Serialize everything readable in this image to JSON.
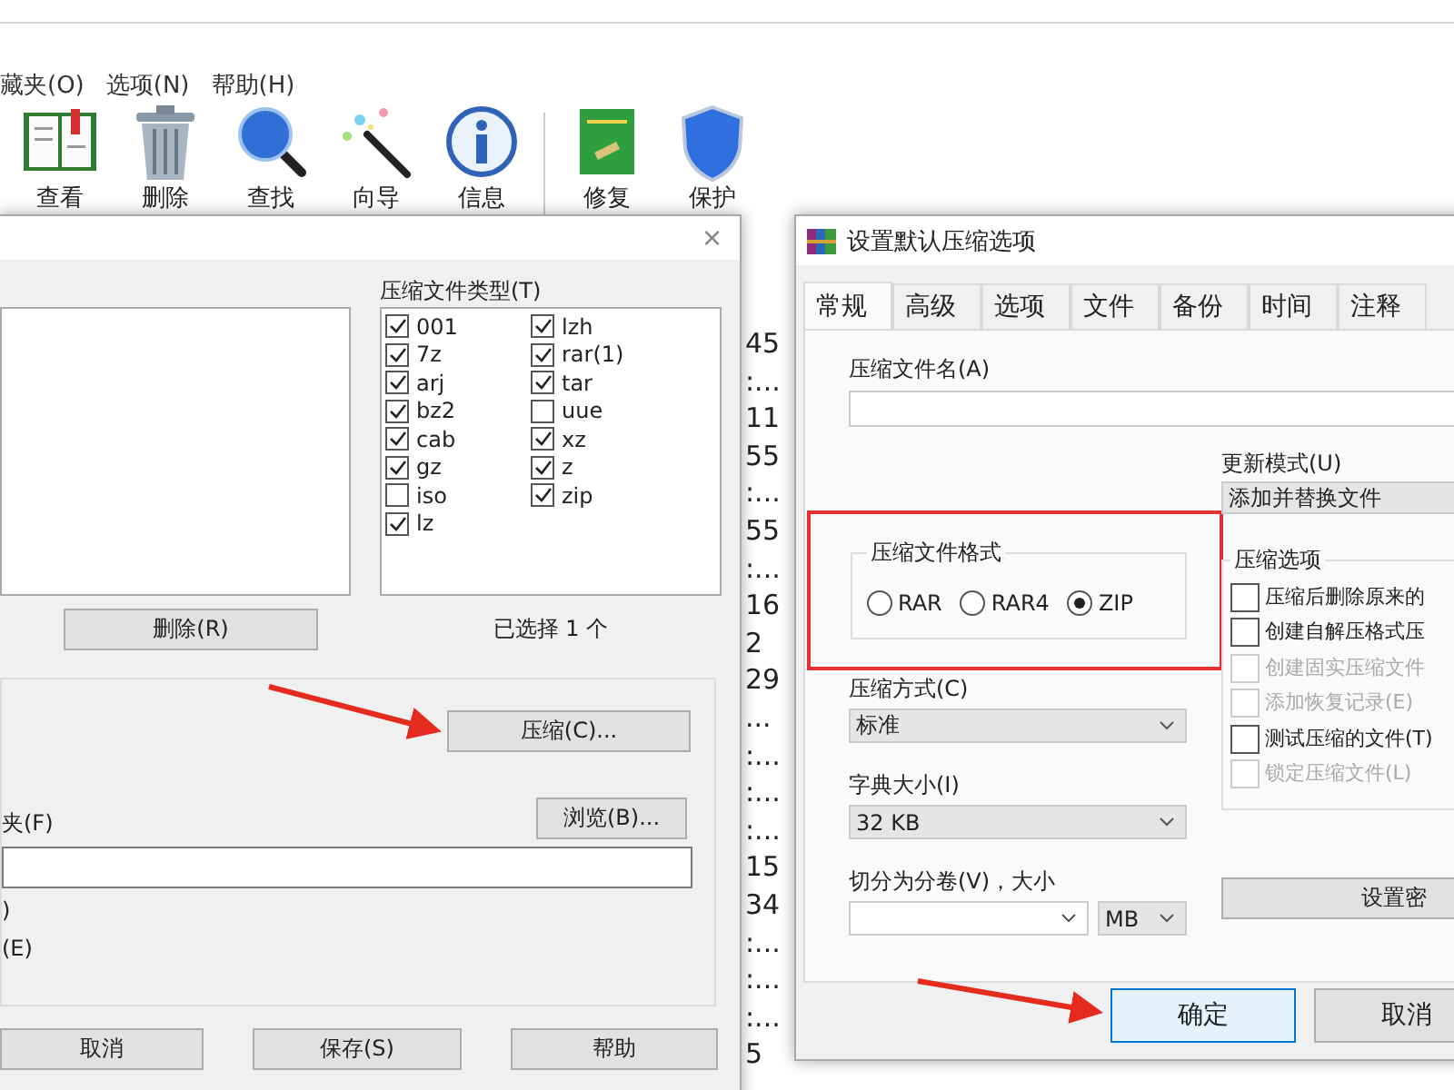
{
  "main_window": {
    "menu": [
      "藏夹(O)",
      "选项(N)",
      "帮助(H)"
    ],
    "toolbar_groups": [
      {
        "buttons": [
          {
            "label": "查看",
            "kind": "book"
          },
          {
            "label": "删除",
            "kind": "trash"
          },
          {
            "label": "查找",
            "kind": "magnifier"
          },
          {
            "label": "向导",
            "kind": "wand"
          },
          {
            "label": "信息",
            "kind": "info"
          }
        ]
      },
      {
        "buttons": [
          {
            "label": "修复",
            "kind": "repair"
          },
          {
            "label": "保护",
            "kind": "shield"
          }
        ]
      }
    ],
    "list_column": [
      "45",
      ":...",
      "11",
      "55",
      ":...",
      "55",
      ":...",
      "16",
      "2",
      "29",
      "...",
      ":...",
      ":...",
      ":...",
      "15",
      "34",
      ":...",
      ":...",
      ":...",
      "5"
    ]
  },
  "archive_types_dialog": {
    "close": "×",
    "types_label": "压缩文件类型(T)",
    "types": [
      {
        "label": "001",
        "checked": true
      },
      {
        "label": "7z",
        "checked": true
      },
      {
        "label": "arj",
        "checked": true
      },
      {
        "label": "bz2",
        "checked": true
      },
      {
        "label": "cab",
        "checked": true
      },
      {
        "label": "gz",
        "checked": true
      },
      {
        "label": "iso",
        "checked": false
      },
      {
        "label": "lz",
        "checked": true
      },
      {
        "label": "lzh",
        "checked": true
      },
      {
        "label": "rar(1)",
        "checked": true
      },
      {
        "label": "tar",
        "checked": true
      },
      {
        "label": "uue",
        "checked": false
      },
      {
        "label": "xz",
        "checked": true
      },
      {
        "label": "z",
        "checked": true
      },
      {
        "label": "zip",
        "checked": true
      }
    ],
    "delete_button": "删除(R)",
    "selection_count": "已选择 1 个",
    "compress_button": "压缩(C)...",
    "folder_label": "夹(F)",
    "browse_button": "浏览(B)...",
    "option_lines": [
      ")",
      "(E)"
    ],
    "buttons": [
      "取消",
      "保存(S)",
      "帮助"
    ]
  },
  "default_options_dialog": {
    "title": "设置默认压缩选项",
    "tabs": [
      {
        "label": "常规",
        "selected": true
      },
      {
        "label": "高级",
        "selected": false
      },
      {
        "label": "选项",
        "selected": false
      },
      {
        "label": "文件",
        "selected": false
      },
      {
        "label": "备份",
        "selected": false
      },
      {
        "label": "时间",
        "selected": false
      },
      {
        "label": "注释",
        "selected": false
      }
    ],
    "archive_name_label": "压缩文件名(A)",
    "update_mode": {
      "label": "更新模式(U)",
      "value": "添加并替换文件"
    },
    "format_group": {
      "title": "压缩文件格式",
      "options": [
        {
          "label": "RAR",
          "selected": false
        },
        {
          "label": "RAR4",
          "selected": false
        },
        {
          "label": "ZIP",
          "selected": true
        }
      ]
    },
    "method": {
      "label": "压缩方式(C)",
      "value": "标准"
    },
    "dictionary": {
      "label": "字典大小(I)",
      "value": "32 KB"
    },
    "split": {
      "label": "切分为分卷(V)，大小",
      "unit": "MB"
    },
    "options_group": {
      "title": "压缩选项",
      "items": [
        {
          "label": "压缩后删除原来的",
          "checked": false,
          "disabled": false
        },
        {
          "label": "创建自解压格式压",
          "checked": false,
          "disabled": false
        },
        {
          "label": "创建固实压缩文件",
          "checked": false,
          "disabled": true
        },
        {
          "label": "添加恢复记录(E)",
          "checked": false,
          "disabled": true
        },
        {
          "label": "测试压缩的文件(T)",
          "checked": false,
          "disabled": false
        },
        {
          "label": "锁定压缩文件(L)",
          "checked": false,
          "disabled": true
        }
      ]
    },
    "password_button": "设置密",
    "buttons": [
      {
        "label": "确定",
        "default": true
      },
      {
        "label": "取消",
        "default": false
      }
    ]
  }
}
